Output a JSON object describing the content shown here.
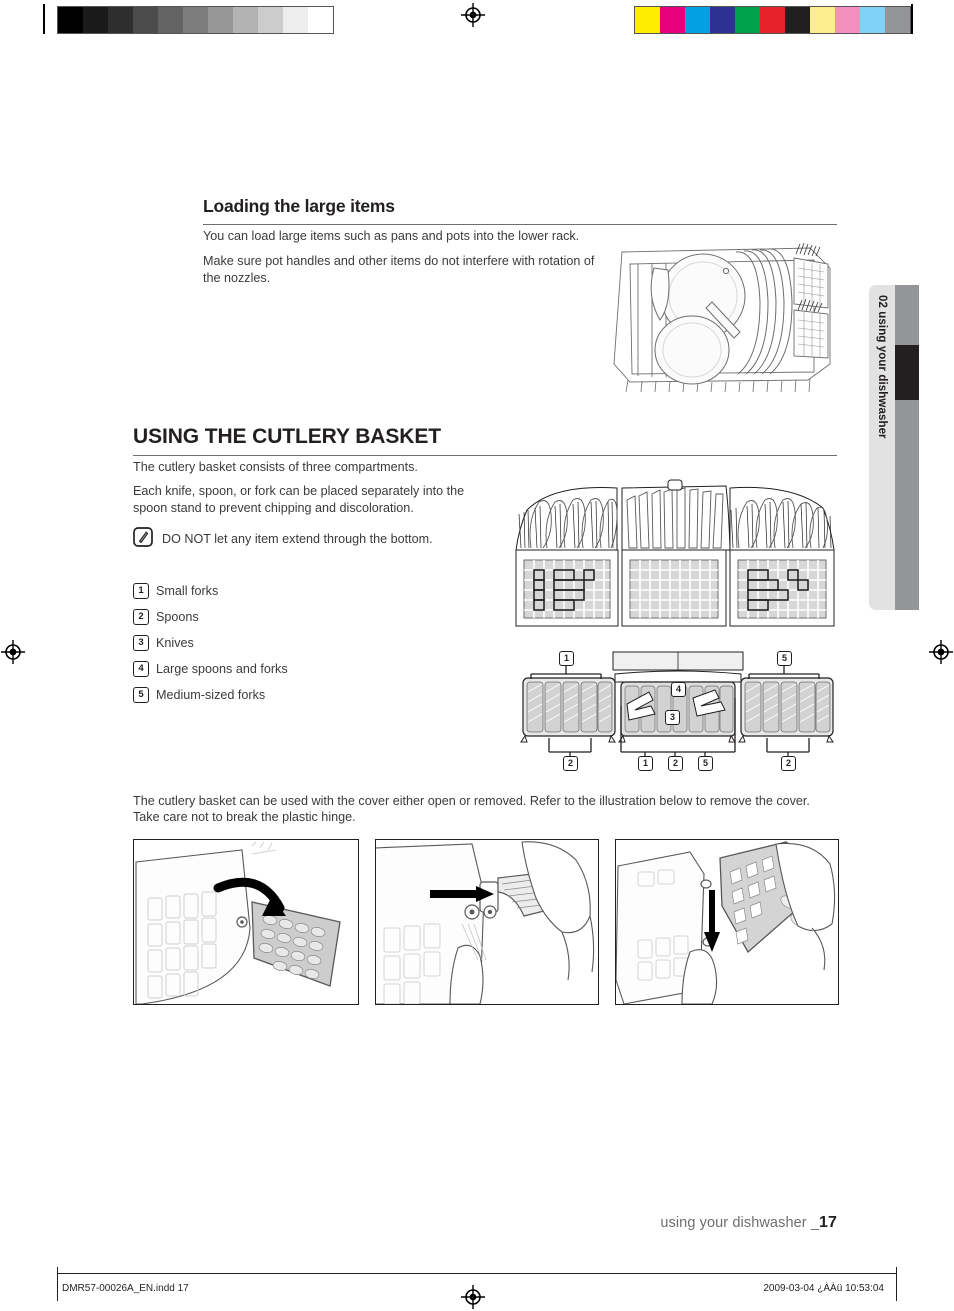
{
  "document": {
    "section_tab": "02 using your dishwasher",
    "page_footer_text": "using your dishwasher _",
    "page_number": "17",
    "print_file": "DMR57-00026A_EN.indd   17",
    "print_timestamp": "2009-03-04   ¿ÀÀü 10:53:04"
  },
  "sections": {
    "large_items": {
      "heading": "Loading the large items",
      "paragraphs": [
        "You can load large items such as pans and pots into the lower rack.",
        "Make sure pot handles and other items do not interfere with rotation of the nozzles."
      ]
    },
    "cutlery_basket": {
      "heading": "USING THE CUTLERY BASKET",
      "paragraphs": [
        "The cutlery basket consists of three compartments.",
        "Each knife, spoon, or fork can be placed separately into the spoon stand to prevent chipping and discoloration."
      ],
      "note": "DO NOT let any item extend through the bottom.",
      "legend": [
        {
          "num": "1",
          "label": "Small forks"
        },
        {
          "num": "2",
          "label": "Spoons"
        },
        {
          "num": "3",
          "label": "Knives"
        },
        {
          "num": "4",
          "label": "Large spoons and forks"
        },
        {
          "num": "5",
          "label": "Medium-sized forks"
        }
      ],
      "closing": "The cutlery basket can be used with the cover either open or removed. Refer to the illustration below to remove the cover. Take care not to break the plastic hinge."
    }
  },
  "diagram_callouts": {
    "left_top": "1",
    "left_bottom": "2",
    "center_upper": "4",
    "center_lower": "3",
    "center_bottom": [
      "1",
      "2",
      "5"
    ],
    "right_top": "5",
    "right_bottom": "2"
  },
  "printer_marks": {
    "grayscale_steps": [
      "#000000",
      "#1a1a1a",
      "#2e2e2e",
      "#4b4b4b",
      "#636363",
      "#7d7d7d",
      "#979797",
      "#b3b3b3",
      "#cccccc",
      "#ededed",
      "#ffffff"
    ],
    "color_steps": [
      "#ffed00",
      "#e6007e",
      "#00a0e3",
      "#2e3192",
      "#00a14b",
      "#e62129",
      "#231f20",
      "#fcee8f",
      "#f490c0",
      "#7fd2f5",
      "#939598"
    ]
  },
  "icons": {
    "note": "note-pencil-icon",
    "registration": "registration-target-icon"
  }
}
